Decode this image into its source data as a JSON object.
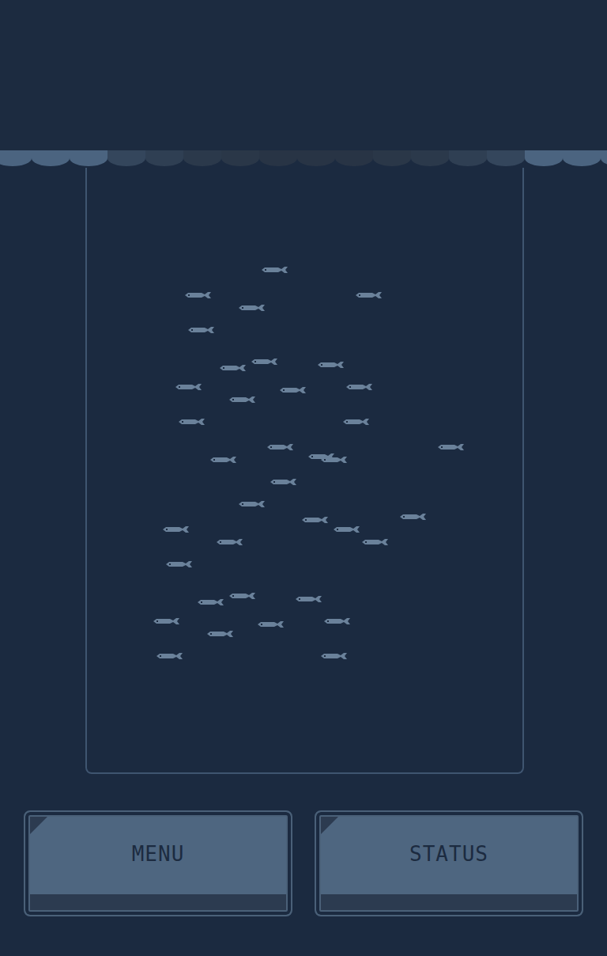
{
  "buttons": [
    {
      "label": "MENU"
    },
    {
      "label": "STATUS"
    }
  ]
}
